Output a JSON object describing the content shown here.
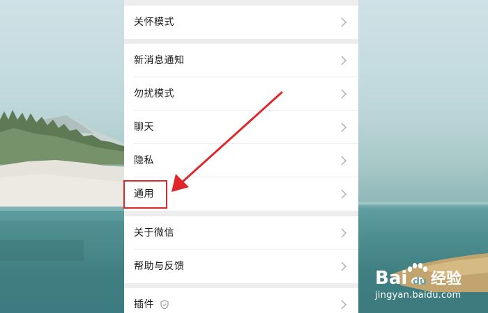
{
  "settings": {
    "items": [
      {
        "label": "关怀模式"
      },
      {
        "label": "新消息通知"
      },
      {
        "label": "勿扰模式"
      },
      {
        "label": "聊天"
      },
      {
        "label": "隐私"
      },
      {
        "label": "通用"
      },
      {
        "label": "关于微信"
      },
      {
        "label": "帮助与反馈"
      },
      {
        "label": "插件"
      }
    ]
  },
  "annotation": {
    "highlight_color": "#e0262b",
    "highlighted_item": "通用"
  },
  "watermark": {
    "logo_text": "Bai du 经验",
    "site": "jingyan.baidu.com"
  },
  "colors": {
    "panel_bg": "#ededed",
    "row_bg": "#ffffff",
    "text": "#191919",
    "chevron": "#b2b2b2"
  },
  "icons": {
    "row_chevron": "chevron-right-icon",
    "plugin_badge": "shield-icon",
    "watermark_paw": "paw-icon"
  }
}
